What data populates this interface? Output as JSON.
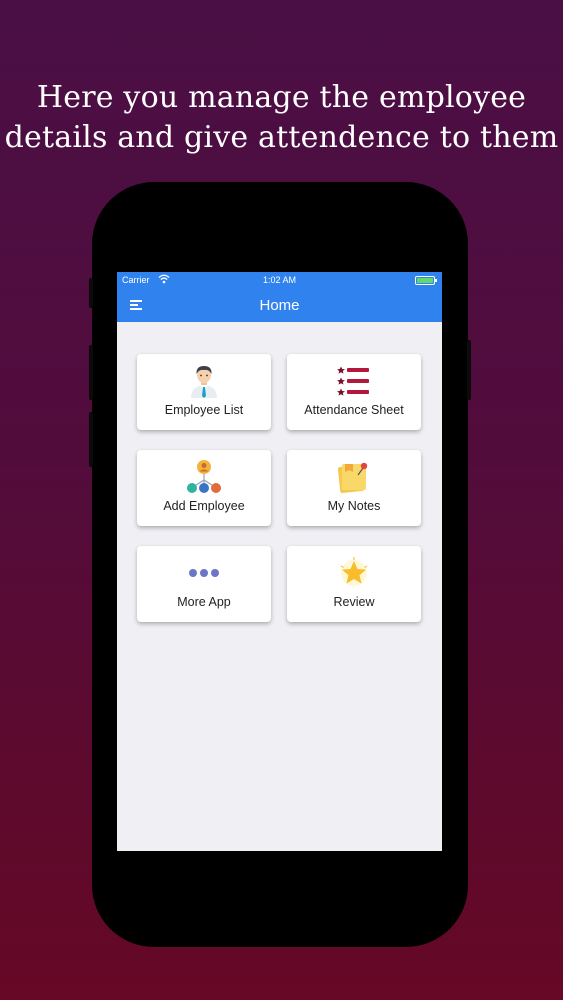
{
  "headline": {
    "line1": "Here you manage the employee",
    "line2": "details and give attendence to them"
  },
  "status_bar": {
    "carrier": "Carrier",
    "time": "1:02 AM",
    "battery_color": "#62d96b"
  },
  "nav": {
    "title": "Home",
    "menu_icon": "hamburger-menu-icon",
    "color": "#3083ef"
  },
  "menu": [
    {
      "label": "Employee List",
      "icon": "employee-icon"
    },
    {
      "label": "Attendance Sheet",
      "icon": "list-icon"
    },
    {
      "label": "Add Employee",
      "icon": "org-chart-icon"
    },
    {
      "label": "My Notes",
      "icon": "notes-icon"
    },
    {
      "label": "More App",
      "icon": "more-dots-icon"
    },
    {
      "label": "Review",
      "icon": "star-icon"
    }
  ]
}
